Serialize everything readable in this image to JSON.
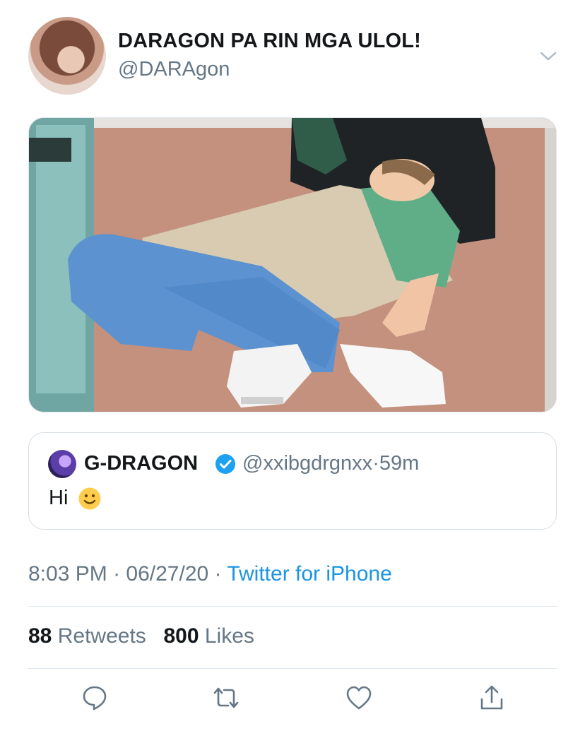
{
  "author": {
    "display_name": "DARAGON PA RIN MGA ULOL!",
    "handle": "@DARAgon"
  },
  "icons": {
    "menu": "chevron-down-icon",
    "verified": "verified-badge-icon",
    "reply": "reply-icon",
    "retweet": "retweet-icon",
    "like": "heart-icon",
    "share": "share-icon"
  },
  "quoted_tweet": {
    "display_name": "G-DRAGON",
    "handle": "@xxibgdrgnxx",
    "separator": "·",
    "time": "59m",
    "text": "Hi"
  },
  "timestamp": {
    "time": "8:03 PM",
    "sep1": "·",
    "date": "06/27/20",
    "sep2": "·",
    "source": "Twitter for iPhone"
  },
  "stats": {
    "retweets_count": "88",
    "retweets_label": "Retweets",
    "likes_count": "800",
    "likes_label": "Likes"
  },
  "colors": {
    "accent": "#1b95e0",
    "secondary_text": "#657786",
    "verified": "#1da1f2"
  }
}
